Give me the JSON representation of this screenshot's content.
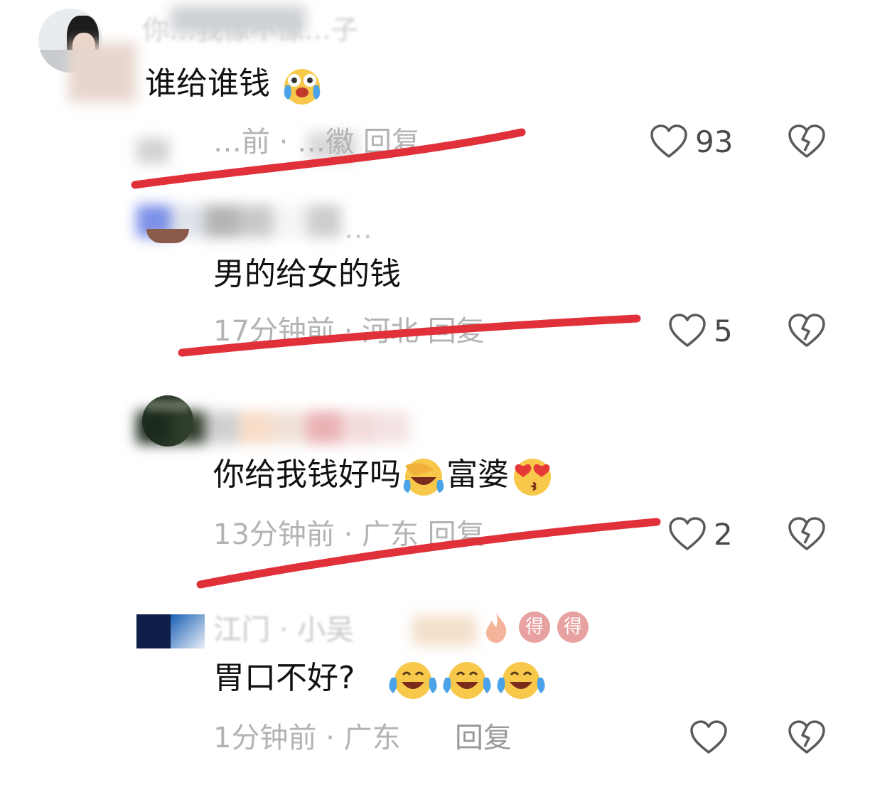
{
  "comments": [
    {
      "name": "你…我像不像…子",
      "text": "谁给谁钱",
      "text_emoji": "crying-laughing-icon",
      "meta": "…前 · …徽   回复",
      "likes": "93"
    },
    {
      "name": "…",
      "text": "男的给女的钱",
      "meta": "17分钟前 · 河北   回复",
      "likes": "5"
    },
    {
      "name": "",
      "text": "你给我钱好吗",
      "text_mid": "富婆",
      "meta": "13分钟前 · 广东   回复",
      "likes": "2"
    },
    {
      "name": "江门 · 小吴",
      "badges": [
        "得",
        "得"
      ],
      "text": "胃口不好?",
      "meta": "1分钟前 · 广东",
      "reply": "回复",
      "likes": ""
    }
  ],
  "colors": {
    "strike": "#e0303a",
    "icon": "#5a5a5a",
    "meta": "#b3b3b3"
  }
}
